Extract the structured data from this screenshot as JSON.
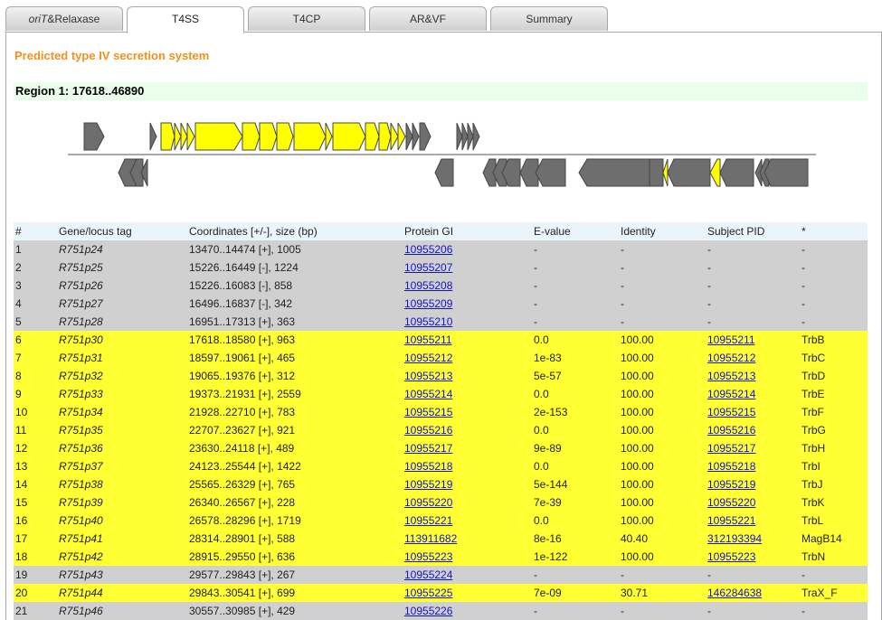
{
  "tabs": [
    {
      "label_em": "oriT",
      "label": "&Relaxase",
      "active": false
    },
    {
      "label_em": "",
      "label": "T4SS",
      "active": true
    },
    {
      "label_em": "",
      "label": "T4CP",
      "active": false
    },
    {
      "label_em": "",
      "label": "AR&VF",
      "active": false
    },
    {
      "label_em": "",
      "label": "Summary",
      "active": false
    }
  ],
  "heading": "Predicted type IV secretion system",
  "region": "Region 1: 17618..46890",
  "colors": {
    "gray_gene": "#6e6e6e",
    "yellow_gene": "#ffff00",
    "heading": "#f39018",
    "row_gray": "#d0d0d0",
    "row_yellow": "#ffff33",
    "region_bg": "#eaffea",
    "link": "#1515c8"
  },
  "table": {
    "headers": [
      "#",
      "Gene/locus tag",
      "Coordinates [+/-], size (bp)",
      "Protein GI",
      "E-value",
      "Identity",
      "Subject PID",
      "*"
    ],
    "rows": [
      {
        "n": "1",
        "tag": "R751p24",
        "coords": "13470..14474 [+], 1005",
        "gi": "10955206",
        "evalue": "-",
        "identity": "-",
        "pid": "-",
        "name": "-",
        "hl": false
      },
      {
        "n": "2",
        "tag": "R751p25",
        "coords": "15226..16449 [-], 1224",
        "gi": "10955207",
        "evalue": "-",
        "identity": "-",
        "pid": "-",
        "name": "-",
        "hl": false
      },
      {
        "n": "3",
        "tag": "R751p26",
        "coords": "15226..16083 [-], 858",
        "gi": "10955208",
        "evalue": "-",
        "identity": "-",
        "pid": "-",
        "name": "-",
        "hl": false
      },
      {
        "n": "4",
        "tag": "R751p27",
        "coords": "16496..16837 [-], 342",
        "gi": "10955209",
        "evalue": "-",
        "identity": "-",
        "pid": "-",
        "name": "-",
        "hl": false
      },
      {
        "n": "5",
        "tag": "R751p28",
        "coords": "16951..17313 [+], 363",
        "gi": "10955210",
        "evalue": "-",
        "identity": "-",
        "pid": "-",
        "name": "-",
        "hl": false
      },
      {
        "n": "6",
        "tag": "R751p30",
        "coords": "17618..18580 [+], 963",
        "gi": "10955211",
        "evalue": "0.0",
        "identity": "100.00",
        "pid": "10955211",
        "name": "TrbB",
        "hl": true
      },
      {
        "n": "7",
        "tag": "R751p31",
        "coords": "18597..19061 [+], 465",
        "gi": "10955212",
        "evalue": "1e-83",
        "identity": "100.00",
        "pid": "10955212",
        "name": "TrbC",
        "hl": true
      },
      {
        "n": "8",
        "tag": "R751p32",
        "coords": "19065..19376 [+], 312",
        "gi": "10955213",
        "evalue": "5e-57",
        "identity": "100.00",
        "pid": "10955213",
        "name": "TrbD",
        "hl": true
      },
      {
        "n": "9",
        "tag": "R751p33",
        "coords": "19373..21931 [+], 2559",
        "gi": "10955214",
        "evalue": "0.0",
        "identity": "100.00",
        "pid": "10955214",
        "name": "TrbE",
        "hl": true
      },
      {
        "n": "10",
        "tag": "R751p34",
        "coords": "21928..22710 [+], 783",
        "gi": "10955215",
        "evalue": "2e-153",
        "identity": "100.00",
        "pid": "10955215",
        "name": "TrbF",
        "hl": true
      },
      {
        "n": "11",
        "tag": "R751p35",
        "coords": "22707..23627 [+], 921",
        "gi": "10955216",
        "evalue": "0.0",
        "identity": "100.00",
        "pid": "10955216",
        "name": "TrbG",
        "hl": true
      },
      {
        "n": "12",
        "tag": "R751p36",
        "coords": "23630..24118 [+], 489",
        "gi": "10955217",
        "evalue": "9e-89",
        "identity": "100.00",
        "pid": "10955217",
        "name": "TrbH",
        "hl": true
      },
      {
        "n": "13",
        "tag": "R751p37",
        "coords": "24123..25544 [+], 1422",
        "gi": "10955218",
        "evalue": "0.0",
        "identity": "100.00",
        "pid": "10955218",
        "name": "TrbI",
        "hl": true
      },
      {
        "n": "14",
        "tag": "R751p38",
        "coords": "25565..26329 [+], 765",
        "gi": "10955219",
        "evalue": "5e-144",
        "identity": "100.00",
        "pid": "10955219",
        "name": "TrbJ",
        "hl": true
      },
      {
        "n": "15",
        "tag": "R751p39",
        "coords": "26340..26567 [+], 228",
        "gi": "10955220",
        "evalue": "7e-39",
        "identity": "100.00",
        "pid": "10955220",
        "name": "TrbK",
        "hl": true
      },
      {
        "n": "16",
        "tag": "R751p40",
        "coords": "26578..28296 [+], 1719",
        "gi": "10955221",
        "evalue": "0.0",
        "identity": "100.00",
        "pid": "10955221",
        "name": "TrbL",
        "hl": true
      },
      {
        "n": "17",
        "tag": "R751p41",
        "coords": "28314..28901 [+], 588",
        "gi": "113911682",
        "evalue": "8e-16",
        "identity": "40.40",
        "pid": "312193394",
        "name": "MagB14",
        "hl": true
      },
      {
        "n": "18",
        "tag": "R751p42",
        "coords": "28915..29550 [+], 636",
        "gi": "10955223",
        "evalue": "1e-122",
        "identity": "100.00",
        "pid": "10955223",
        "name": "TrbN",
        "hl": true
      },
      {
        "n": "19",
        "tag": "R751p43",
        "coords": "29577..29843 [+], 267",
        "gi": "10955224",
        "evalue": "-",
        "identity": "-",
        "pid": "-",
        "name": "-",
        "hl": false
      },
      {
        "n": "20",
        "tag": "R751p44",
        "coords": "29843..30541 [+], 699",
        "gi": "10955225",
        "evalue": "7e-09",
        "identity": "30.71",
        "pid": "146284638",
        "name": "TraX_F",
        "hl": true
      },
      {
        "n": "21",
        "tag": "R751p46",
        "coords": "30557..30985 [+], 429",
        "gi": "10955226",
        "evalue": "-",
        "identity": "-",
        "pid": "-",
        "name": "-",
        "hl": false
      }
    ]
  }
}
